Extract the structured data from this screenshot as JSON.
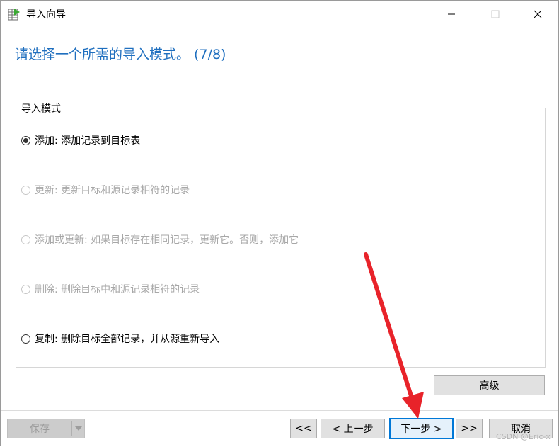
{
  "window": {
    "title": "导入向导",
    "icon": "table-import-icon",
    "controls": [
      "minimize-icon",
      "maximize-icon",
      "close-icon"
    ]
  },
  "heading": "请选择一个所需的导入模式。 (7/8)",
  "group": {
    "label": "导入模式",
    "options": [
      {
        "label": "添加: 添加记录到目标表",
        "checked": true,
        "enabled": true
      },
      {
        "label": "更新: 更新目标和源记录相符的记录",
        "checked": false,
        "enabled": false
      },
      {
        "label": "添加或更新: 如果目标存在相同记录，更新它。否则，添加它",
        "checked": false,
        "enabled": false
      },
      {
        "label": "删除: 删除目标中和源记录相符的记录",
        "checked": false,
        "enabled": false
      },
      {
        "label": "复制: 删除目标全部记录，并从源重新导入",
        "checked": false,
        "enabled": true
      }
    ]
  },
  "buttons": {
    "advanced": "高级",
    "save": "保存",
    "first": "<<",
    "prev": "< 上一步",
    "next": "下一步 >",
    "last": ">>",
    "cancel": "取消"
  },
  "watermark": "CSDN @Eric-x",
  "colors": {
    "heading": "#1f6fbf",
    "annotation_arrow": "#e8232a",
    "primary_border": "#0078d7"
  }
}
